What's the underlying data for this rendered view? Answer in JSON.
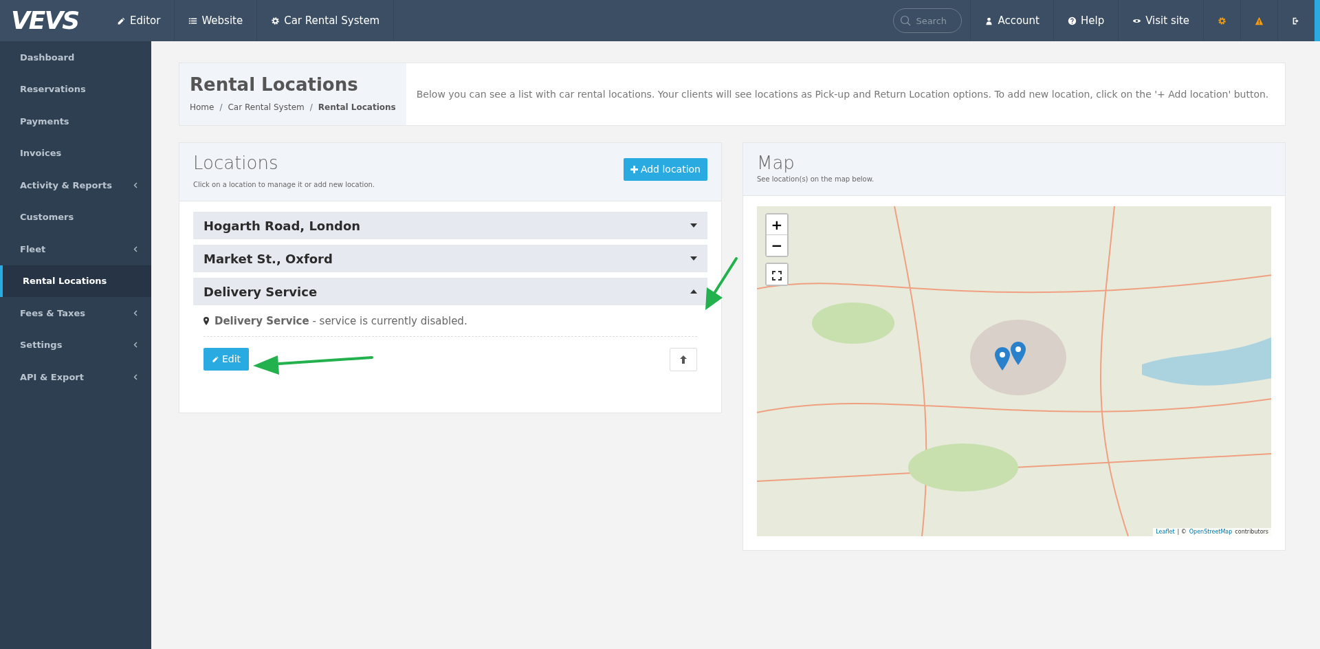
{
  "brand": {
    "logo": "VEVS"
  },
  "top_nav": [
    {
      "label": "Editor"
    },
    {
      "label": "Website"
    },
    {
      "label": "Car Rental System"
    }
  ],
  "search": {
    "placeholder": "Search"
  },
  "right_nav": [
    {
      "label": "Account"
    },
    {
      "label": "Help"
    },
    {
      "label": "Visit site"
    }
  ],
  "sidebar": {
    "items": [
      {
        "label": "Dashboard",
        "has_submenu": false,
        "selected": false
      },
      {
        "label": "Reservations",
        "has_submenu": false,
        "selected": false
      },
      {
        "label": "Payments",
        "has_submenu": false,
        "selected": false
      },
      {
        "label": "Invoices",
        "has_submenu": false,
        "selected": false
      },
      {
        "label": "Activity & Reports",
        "has_submenu": true,
        "selected": false
      },
      {
        "label": "Customers",
        "has_submenu": false,
        "selected": false
      },
      {
        "label": "Fleet",
        "has_submenu": true,
        "selected": false
      },
      {
        "label": "Rental Locations",
        "has_submenu": false,
        "selected": true
      },
      {
        "label": "Fees & Taxes",
        "has_submenu": true,
        "selected": false
      },
      {
        "label": "Settings",
        "has_submenu": true,
        "selected": false
      },
      {
        "label": "API & Export",
        "has_submenu": true,
        "selected": false
      }
    ]
  },
  "page_header": {
    "title": "Rental Locations",
    "breadcrumb_separator": "/",
    "breadcrumb": [
      {
        "label": "Home",
        "current": false
      },
      {
        "label": "Car Rental System",
        "current": false
      },
      {
        "label": "Rental Locations",
        "current": true
      }
    ],
    "description": "Below you can see a list with car rental locations. Your clients will see locations as Pick-up and Return Location options. To add new location, click on the '+ Add location' button."
  },
  "locations_panel": {
    "title": "Locations",
    "subtitle": "Click on a location to manage it or add new location.",
    "add_button": "Add location",
    "items": [
      {
        "name": "Hogarth Road, London",
        "expanded": false
      },
      {
        "name": "Market St., Oxford",
        "expanded": false
      },
      {
        "name": "Delivery Service",
        "expanded": true,
        "detail": "**Delivery Service** - service is currently disabled.",
        "edit_button": "Edit"
      }
    ]
  },
  "map_panel": {
    "title": "Map",
    "subtitle": "See location(s) on the map below.",
    "zoom_in": "+",
    "zoom_out": "−",
    "attribution": [
      {
        "text": "Leaflet",
        "link": true
      },
      {
        "text": "| ©",
        "link": false
      },
      {
        "text": "OpenStreetMap",
        "link": true
      },
      {
        "text": "contributors",
        "link": false
      }
    ]
  }
}
